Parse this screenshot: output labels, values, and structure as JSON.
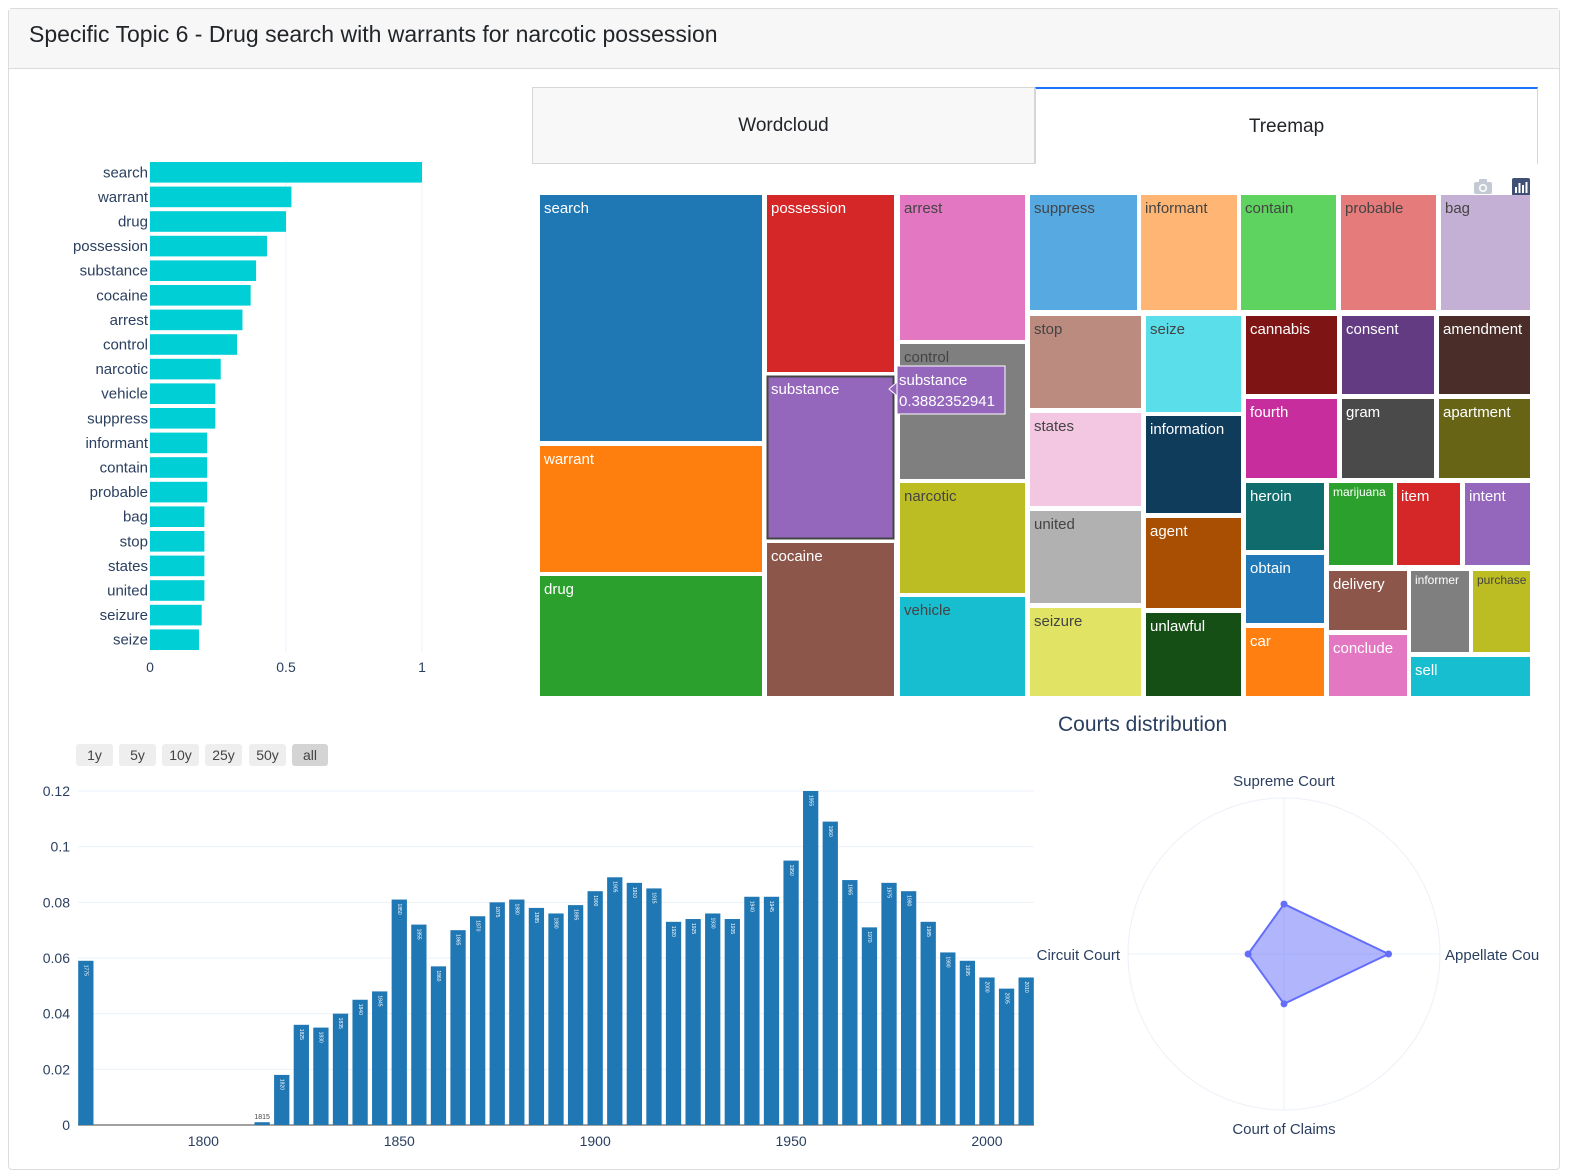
{
  "header": {
    "title": "Specific Topic 6 - Drug search with warrants for narcotic possession"
  },
  "tabs": [
    {
      "label": "Wordcloud",
      "active": false
    },
    {
      "label": "Treemap",
      "active": true
    }
  ],
  "range_selector": {
    "buttons": [
      "1y",
      "5y",
      "10y",
      "25y",
      "50y",
      "all"
    ],
    "active": "all"
  },
  "colors": {
    "term_bar": "#00cfd5",
    "year_bar": "#1f77b4",
    "radar_fill": "#636efa"
  },
  "icons": [
    "camera-icon",
    "plotly-logo-icon"
  ],
  "chart_data": [
    {
      "type": "bar",
      "orientation": "horizontal",
      "categories": [
        "search",
        "warrant",
        "drug",
        "possession",
        "substance",
        "cocaine",
        "arrest",
        "control",
        "narcotic",
        "vehicle",
        "suppress",
        "informant",
        "contain",
        "probable",
        "bag",
        "stop",
        "states",
        "united",
        "seizure",
        "seize"
      ],
      "values": [
        1.0,
        0.52,
        0.5,
        0.43,
        0.39,
        0.37,
        0.34,
        0.32,
        0.26,
        0.24,
        0.24,
        0.21,
        0.21,
        0.21,
        0.2,
        0.2,
        0.2,
        0.2,
        0.19,
        0.18
      ],
      "xlim": [
        0,
        1
      ],
      "xticks": [
        0,
        0.5,
        1
      ],
      "xtick_labels": [
        "0",
        "0.5",
        "1"
      ],
      "grid": true
    },
    {
      "type": "treemap",
      "labels": [
        "search",
        "warrant",
        "drug",
        "possession",
        "substance",
        "cocaine",
        "arrest",
        "control",
        "narcotic",
        "vehicle",
        "suppress",
        "stop",
        "states",
        "united",
        "seizure",
        "informant",
        "seize",
        "information",
        "agent",
        "unlawful",
        "contain",
        "cannabis",
        "fourth",
        "heroin",
        "obtain",
        "car",
        "probable",
        "consent",
        "gram",
        "marijuana",
        "item",
        "delivery",
        "conclude",
        "bag",
        "amendment",
        "apartment",
        "intent",
        "informer",
        "purchase",
        "sell"
      ],
      "tooltip": {
        "label": "substance",
        "value": "0.3882352941"
      }
    },
    {
      "type": "bar",
      "x_label_start": 1775,
      "x": [
        1770,
        1815,
        1820,
        1825,
        1830,
        1835,
        1840,
        1845,
        1850,
        1855,
        1860,
        1865,
        1870,
        1875,
        1880,
        1885,
        1890,
        1895,
        1900,
        1905,
        1910,
        1915,
        1920,
        1925,
        1930,
        1935,
        1940,
        1945,
        1950,
        1955,
        1960,
        1965,
        1970,
        1975,
        1980,
        1985,
        1990,
        1995,
        2000,
        2005,
        2010
      ],
      "values": [
        0.059,
        0.001,
        0.018,
        0.036,
        0.035,
        0.04,
        0.045,
        0.048,
        0.081,
        0.072,
        0.057,
        0.07,
        0.075,
        0.08,
        0.081,
        0.078,
        0.076,
        0.079,
        0.084,
        0.089,
        0.087,
        0.085,
        0.073,
        0.074,
        0.076,
        0.074,
        0.082,
        0.082,
        0.095,
        0.12,
        0.109,
        0.088,
        0.071,
        0.087,
        0.084,
        0.073,
        0.062,
        0.059,
        0.053,
        0.049,
        0.053
      ],
      "xlim": [
        1768,
        2012
      ],
      "ylim": [
        0,
        0.12
      ],
      "xticks": [
        1800,
        1850,
        1900,
        1950,
        2000
      ],
      "yticks": [
        0,
        0.02,
        0.04,
        0.06,
        0.08,
        0.1,
        0.12
      ],
      "ytick_labels": [
        "0",
        "0.02",
        "0.04",
        "0.06",
        "0.08",
        "0.1",
        "0.12"
      ],
      "grid": true
    },
    {
      "type": "radar",
      "title": "Courts distribution",
      "axes": [
        "Supreme Court",
        "Appellate Cou",
        "Court of Claims",
        "Circuit Court"
      ],
      "values": [
        0.32,
        0.67,
        0.32,
        0.23
      ],
      "range": [
        0,
        1
      ]
    }
  ]
}
